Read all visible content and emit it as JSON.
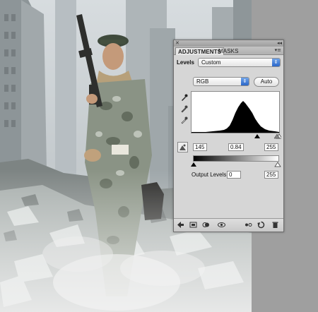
{
  "panel": {
    "close_icon": "close-icon",
    "collapse_icon": "collapse-icon",
    "tabs": [
      {
        "label": "ADJUSTMENTS",
        "active": true
      },
      {
        "label": "MASKS",
        "active": false
      }
    ],
    "menu_icon": "panel-menu-icon",
    "adjustment_name": "Levels",
    "preset": {
      "value": "Custom"
    },
    "channel": {
      "value": "RGB"
    },
    "auto_label": "Auto",
    "input_levels": {
      "black": "145",
      "gamma": "0.84",
      "white": "255"
    },
    "output_levels": {
      "label": "Output Levels:",
      "black": "0",
      "white": "255"
    },
    "bottom_icons": [
      "back-icon",
      "expanded-view-icon",
      "clip-to-layer-icon",
      "visibility-eye-icon",
      "view-previous-state-icon",
      "reset-icon",
      "delete-icon"
    ]
  },
  "colors": {
    "tab_active": "#e6e6e6",
    "select_arrow": "#2a67c9",
    "panel_bg": "#d6d6d6"
  }
}
